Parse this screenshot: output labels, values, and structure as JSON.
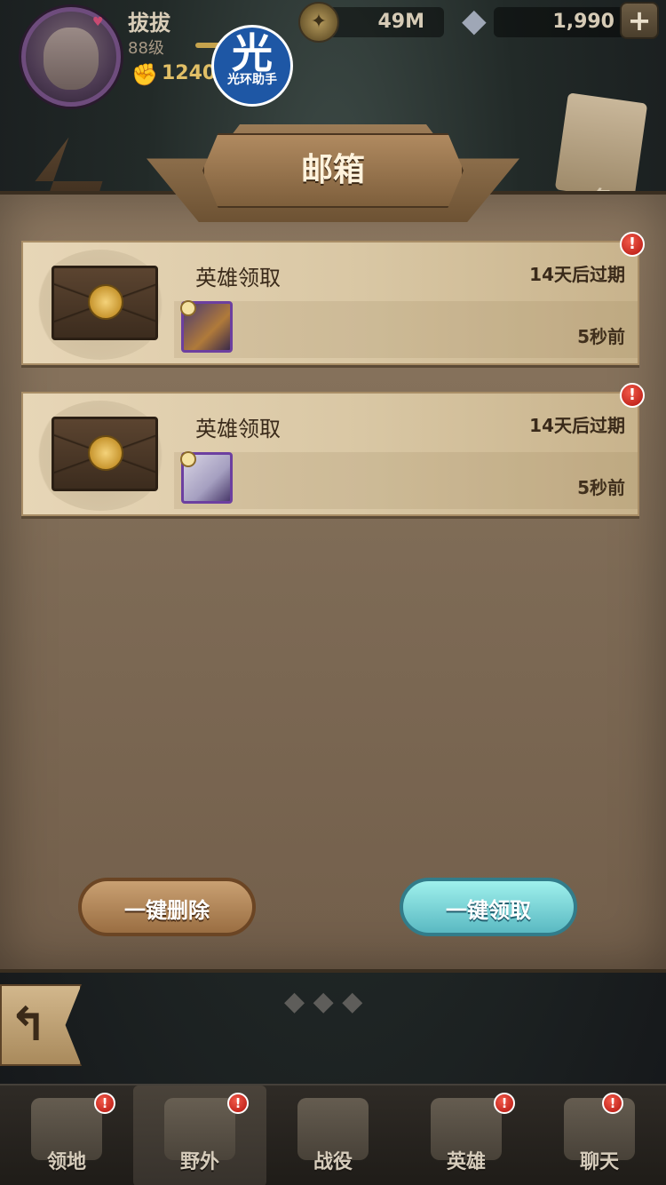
{
  "player": {
    "name": "拔拔",
    "level": "88级",
    "power": "1240"
  },
  "resources": {
    "gold": "49M",
    "gems": "1,990",
    "add_label": "+"
  },
  "watermark": {
    "glyph": "光",
    "text": "光环助手"
  },
  "side": {
    "right_text": "务"
  },
  "mailbox": {
    "title": "邮箱",
    "mails": [
      {
        "subject": "英雄领取",
        "expires": "14天后过期",
        "received": "5秒前",
        "alert": "!"
      },
      {
        "subject": "英雄领取",
        "expires": "14天后过期",
        "received": "5秒前",
        "alert": "!"
      }
    ],
    "delete_all": "一键删除",
    "claim_all": "一键领取"
  },
  "nav": {
    "items": [
      {
        "label": "领地",
        "alert": "!"
      },
      {
        "label": "野外",
        "alert": "!"
      },
      {
        "label": "战役",
        "alert": ""
      },
      {
        "label": "英雄",
        "alert": "!"
      },
      {
        "label": "聊天",
        "alert": "!"
      }
    ],
    "active_index": 1
  },
  "icons": {
    "back": "back-arrow-icon",
    "power": "fist-icon",
    "gold": "gold-coin-icon",
    "gems": "diamond-icon"
  }
}
